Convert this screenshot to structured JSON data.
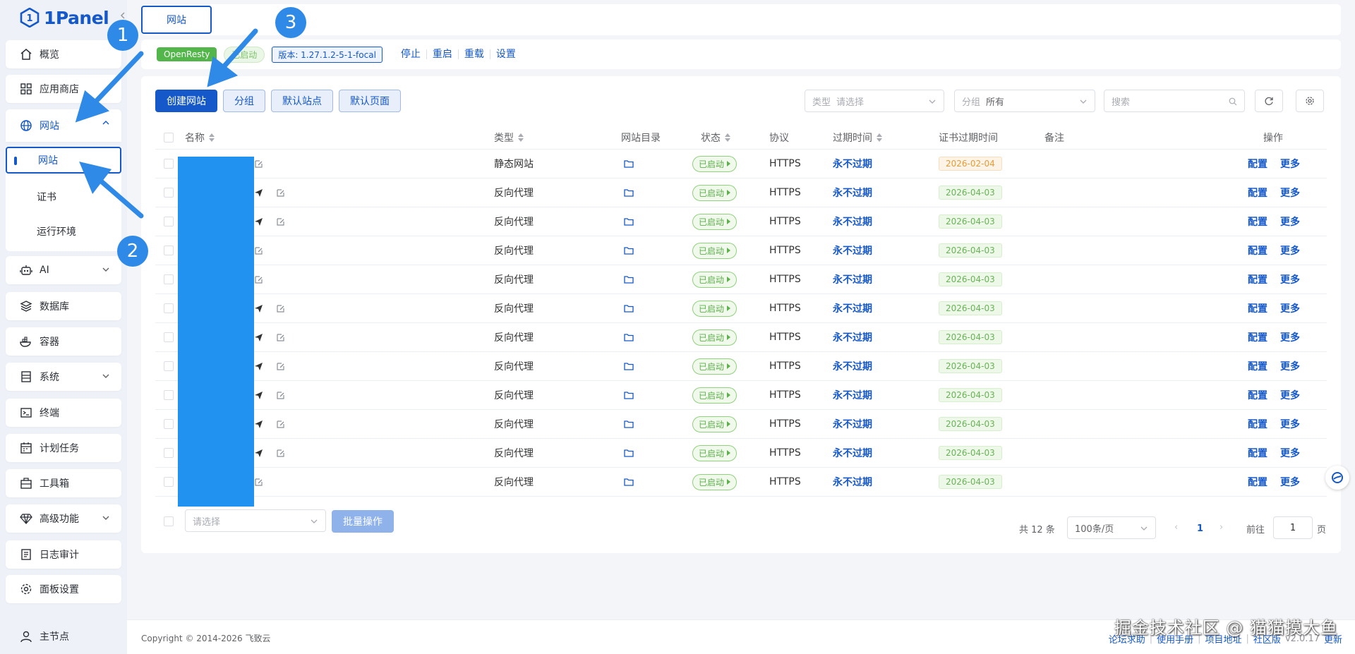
{
  "app": {
    "logo_text": "1Panel"
  },
  "sidebar": {
    "items": [
      {
        "label": "概览",
        "icon": "home-icon"
      },
      {
        "label": "应用商店",
        "icon": "apps-icon"
      },
      {
        "label": "网站",
        "icon": "globe-icon"
      },
      {
        "label": "AI",
        "icon": "robot-icon"
      },
      {
        "label": "数据库",
        "icon": "database-icon"
      },
      {
        "label": "容器",
        "icon": "docker-icon"
      },
      {
        "label": "系统",
        "icon": "server-icon"
      },
      {
        "label": "终端",
        "icon": "terminal-icon"
      },
      {
        "label": "计划任务",
        "icon": "calendar-icon"
      },
      {
        "label": "工具箱",
        "icon": "toolbox-icon"
      },
      {
        "label": "高级功能",
        "icon": "diamond-icon"
      },
      {
        "label": "日志审计",
        "icon": "log-icon"
      },
      {
        "label": "面板设置",
        "icon": "gear-icon"
      }
    ],
    "website_sub": [
      "网站",
      "证书",
      "运行环境"
    ],
    "bottom_label": "主节点"
  },
  "top_tab": "网站",
  "statusbar": {
    "app_name": "OpenResty",
    "state": "已启动",
    "version": "版本: 1.27.1.2-5-1-focal",
    "actions": [
      "停止",
      "重启",
      "重载",
      "设置"
    ]
  },
  "toolbar": {
    "create": "创建网站",
    "group": "分组",
    "default_site": "默认站点",
    "default_page": "默认页面",
    "type_label": "类型",
    "type_placeholder": "请选择",
    "group_label": "分组",
    "group_value": "所有",
    "search_placeholder": "搜索"
  },
  "table": {
    "headers": [
      "名称",
      "类型",
      "网站目录",
      "状态",
      "协议",
      "过期时间",
      "证书过期时间",
      "备注",
      "操作"
    ],
    "rows": [
      {
        "type": "静态网站",
        "status": "已启动",
        "protocol": "HTTPS",
        "expire": "永不过期",
        "cert": "2026-02-04",
        "cert_color": "orange",
        "send": false
      },
      {
        "type": "反向代理",
        "status": "已启动",
        "protocol": "HTTPS",
        "expire": "永不过期",
        "cert": "2026-04-03",
        "cert_color": "green",
        "send": true
      },
      {
        "type": "反向代理",
        "status": "已启动",
        "protocol": "HTTPS",
        "expire": "永不过期",
        "cert": "2026-04-03",
        "cert_color": "green",
        "send": true
      },
      {
        "type": "反向代理",
        "status": "已启动",
        "protocol": "HTTPS",
        "expire": "永不过期",
        "cert": "2026-04-03",
        "cert_color": "green",
        "send": false
      },
      {
        "type": "反向代理",
        "status": "已启动",
        "protocol": "HTTPS",
        "expire": "永不过期",
        "cert": "2026-04-03",
        "cert_color": "green",
        "send": false
      },
      {
        "type": "反向代理",
        "status": "已启动",
        "protocol": "HTTPS",
        "expire": "永不过期",
        "cert": "2026-04-03",
        "cert_color": "green",
        "send": true
      },
      {
        "type": "反向代理",
        "status": "已启动",
        "protocol": "HTTPS",
        "expire": "永不过期",
        "cert": "2026-04-03",
        "cert_color": "green",
        "send": true
      },
      {
        "type": "反向代理",
        "status": "已启动",
        "protocol": "HTTPS",
        "expire": "永不过期",
        "cert": "2026-04-03",
        "cert_color": "green",
        "send": true
      },
      {
        "type": "反向代理",
        "status": "已启动",
        "protocol": "HTTPS",
        "expire": "永不过期",
        "cert": "2026-04-03",
        "cert_color": "green",
        "send": true
      },
      {
        "type": "反向代理",
        "status": "已启动",
        "protocol": "HTTPS",
        "expire": "永不过期",
        "cert": "2026-04-03",
        "cert_color": "green",
        "send": true
      },
      {
        "type": "反向代理",
        "status": "已启动",
        "protocol": "HTTPS",
        "expire": "永不过期",
        "cert": "2026-04-03",
        "cert_color": "green",
        "send": true
      },
      {
        "type": "反向代理",
        "status": "已启动",
        "protocol": "HTTPS",
        "expire": "永不过期",
        "cert": "2026-04-03",
        "cert_color": "green",
        "send": false
      }
    ],
    "op_config": "配置",
    "op_more": "更多"
  },
  "table_footer": {
    "batch_placeholder": "请选择",
    "batch_button": "批量操作",
    "total": "共 12 条",
    "page_size": "100条/页",
    "current_page": "1",
    "goto_label": "前往",
    "goto_value": "1",
    "page_unit": "页"
  },
  "footer": {
    "copyright": "Copyright © 2014-2026 飞致云",
    "links": [
      "论坛求助",
      "使用手册",
      "项目地址",
      "社区版"
    ],
    "version": "v2.0.17",
    "update": "更新",
    "watermark": "掘金技术社区 @ 猫猫摸大鱼"
  },
  "annotations": [
    "1",
    "2",
    "3"
  ],
  "colors": {
    "primary": "#1558c9",
    "success": "#5db14b",
    "arrow": "#2e8ae6"
  }
}
